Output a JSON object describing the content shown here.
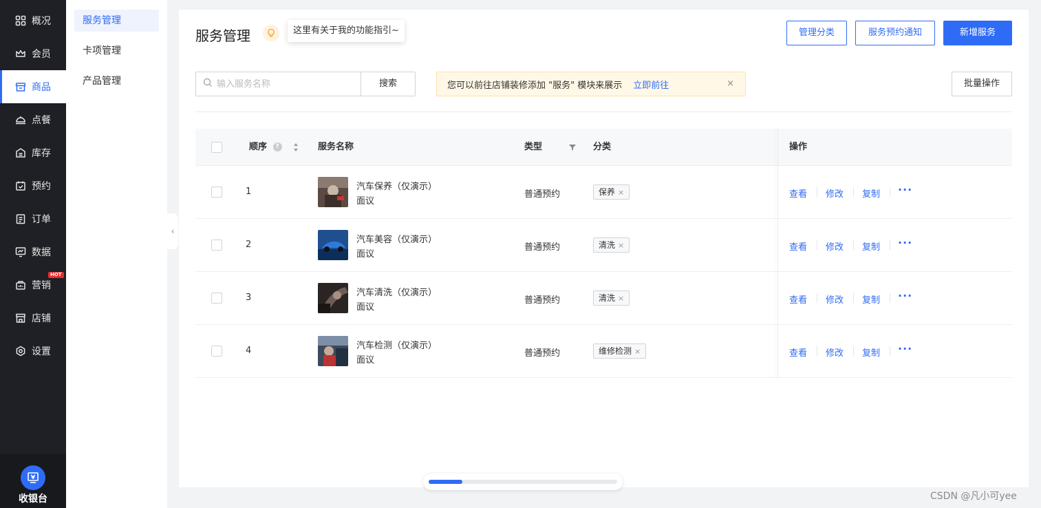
{
  "sidebar": {
    "items": [
      {
        "label": "概况",
        "icon": "dashboard-icon"
      },
      {
        "label": "会员",
        "icon": "crown-icon"
      },
      {
        "label": "商品",
        "icon": "store-icon",
        "active": true
      },
      {
        "label": "点餐",
        "icon": "dish-icon"
      },
      {
        "label": "库存",
        "icon": "inventory-icon"
      },
      {
        "label": "预约",
        "icon": "calendar-check-icon"
      },
      {
        "label": "订单",
        "icon": "order-icon"
      },
      {
        "label": "数据",
        "icon": "chart-icon"
      },
      {
        "label": "营销",
        "icon": "marketing-icon",
        "badge": "HOT"
      },
      {
        "label": "店铺",
        "icon": "shop-icon"
      },
      {
        "label": "设置",
        "icon": "settings-icon"
      }
    ],
    "cashier_label": "收银台"
  },
  "submenu": {
    "items": [
      "服务管理",
      "卡项管理",
      "产品管理"
    ],
    "active": "服务管理"
  },
  "header": {
    "title": "服务管理",
    "guide_tip": "这里有关于我的功能指引~",
    "manage_category": "管理分类",
    "booking_notice": "服务预约通知",
    "add_service": "新增服务"
  },
  "toolbar": {
    "search_placeholder": "输入服务名称",
    "search_button": "搜索",
    "notice_text": "您可以前往店铺装修添加 \"服务\" 模块来展示",
    "notice_link": "立即前往",
    "notice_close": "×",
    "batch_button": "批量操作"
  },
  "table": {
    "headers": {
      "order": "顺序",
      "name": "服务名称",
      "type": "类型",
      "category": "分类",
      "actions": "操作"
    },
    "rows": [
      {
        "order": "1",
        "name": "汽车保养（仅演示）",
        "price": "面议",
        "type": "普通预约",
        "category": "保养"
      },
      {
        "order": "2",
        "name": "汽车美容（仅演示）",
        "price": "面议",
        "type": "普通预约",
        "category": "清洗"
      },
      {
        "order": "3",
        "name": "汽车清洗（仅演示）",
        "price": "面议",
        "type": "普通预约",
        "category": "清洗"
      },
      {
        "order": "4",
        "name": "汽车检测（仅演示）",
        "price": "面议",
        "type": "普通预约",
        "category": "维修检测"
      }
    ],
    "actions": {
      "view": "查看",
      "edit": "修改",
      "copy": "复制",
      "more": "···"
    },
    "tag_close": "×"
  },
  "scrollbar": {
    "position_fraction": 0.18
  },
  "watermark": "CSDN @凡小可yee",
  "colors": {
    "accent": "#2f6cf6",
    "sidebar_bg": "#1e2025",
    "notice_bg": "#fff8e6",
    "hot_badge": "#e62d2d"
  }
}
